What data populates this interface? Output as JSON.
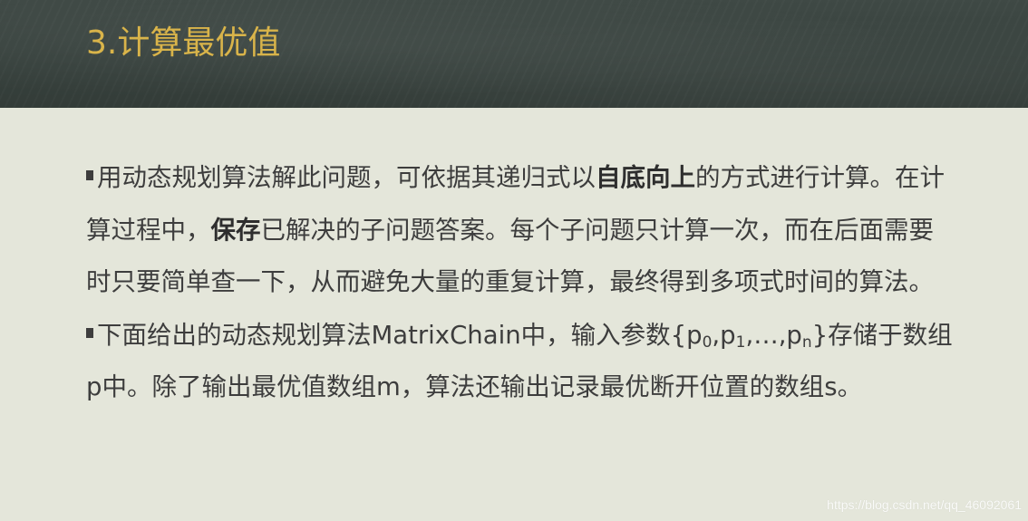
{
  "slide": {
    "title": "3.计算最优值",
    "paragraph1": {
      "text_a": "用动态规划算法解此问题，可依据其递归式以",
      "bold_a": "自底向上",
      "text_b": "的方式进行计算。在计算过程中，",
      "bold_b": "保存",
      "text_c": "已解决的子问题答案。每个子问题只计算一次，而在后面需要时只要简单查一下，从而避免大量的重复计算，最终得到多项式时间的算法。"
    },
    "paragraph2": {
      "text_a": "下面给出的动态规划算法MatrixChain中，输入参数{p",
      "sub_0": "0",
      "text_b": ",p",
      "sub_1": "1",
      "text_c": ",…,p",
      "sub_n": "n",
      "text_d": "}存储于数组p中。除了输出最优值数组m，算法还输出记录最优断开位置的数组s。"
    }
  },
  "watermark": "https://blog.csdn.net/qq_46092061",
  "colors": {
    "header_bg": "#3a4440",
    "title": "#d9b44a",
    "body_bg": "#e4e6da",
    "text": "#3d3d3d"
  }
}
